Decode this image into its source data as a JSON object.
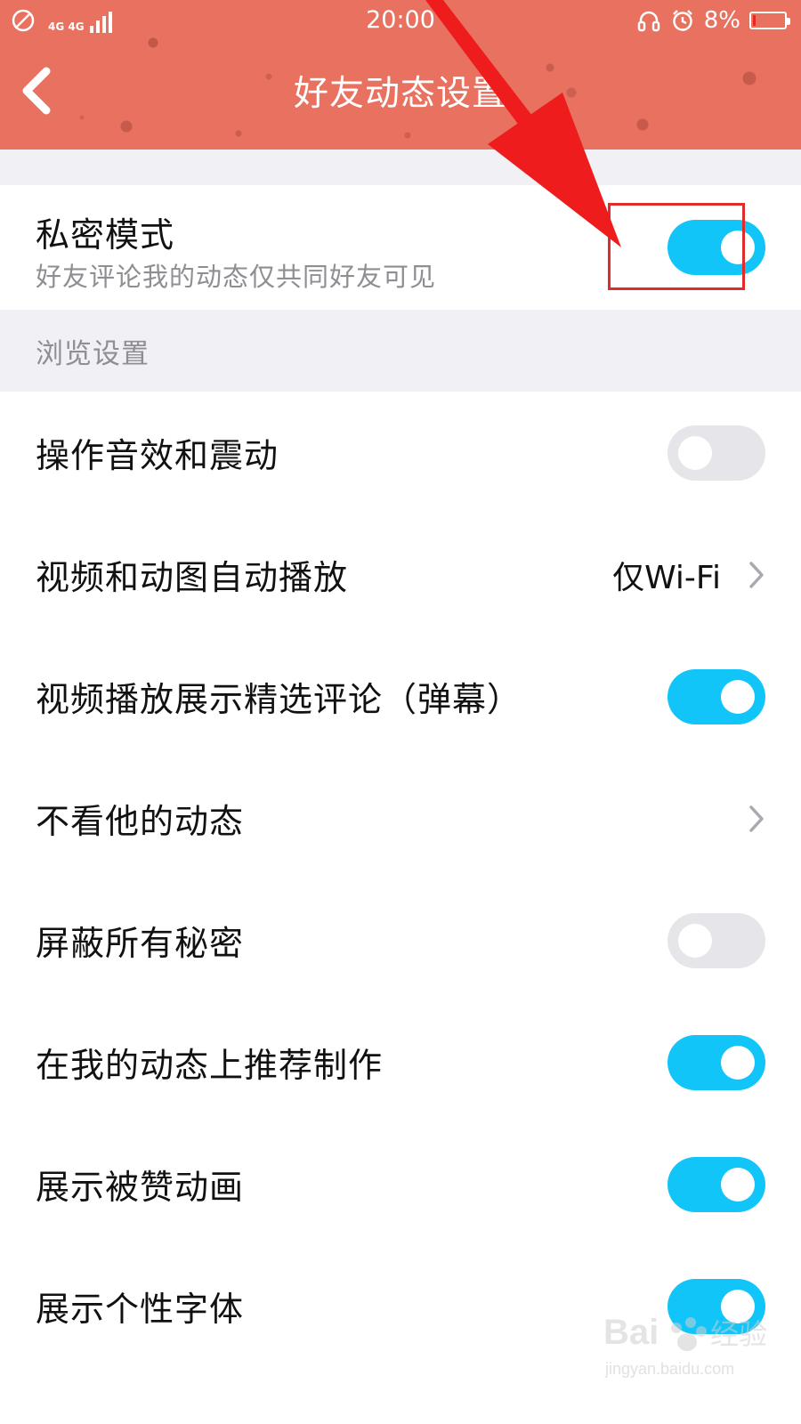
{
  "status_bar": {
    "network_label": "4G 4G",
    "time": "20:00",
    "battery_percent": "8%",
    "battery_level": 0.08
  },
  "header": {
    "title": "好友动态设置"
  },
  "private_mode": {
    "label": "私密模式",
    "subtitle": "好友评论我的动态仅共同好友可见",
    "enabled": true
  },
  "browse_section": {
    "title": "浏览设置",
    "items": [
      {
        "label": "操作音效和震动",
        "type": "toggle",
        "enabled": false
      },
      {
        "label": "视频和动图自动播放",
        "type": "link",
        "value": "仅Wi-Fi"
      },
      {
        "label": "视频播放展示精选评论（弹幕）",
        "type": "toggle",
        "enabled": true
      },
      {
        "label": "不看他的动态",
        "type": "link"
      },
      {
        "label": "屏蔽所有秘密",
        "type": "toggle",
        "enabled": false
      },
      {
        "label": "在我的动态上推荐制作",
        "type": "toggle",
        "enabled": true
      },
      {
        "label": "展示被赞动画",
        "type": "toggle",
        "enabled": true
      },
      {
        "label": "展示个性字体",
        "type": "toggle",
        "enabled": true
      }
    ]
  },
  "watermark": {
    "brand": "Baidu 经验",
    "url": "jingyan.baidu.com"
  },
  "colors": {
    "header_red": "#e8715f",
    "toggle_on": "#12c5f8",
    "toggle_off": "#e6e6ea",
    "annotation_red": "#e02b2b"
  }
}
